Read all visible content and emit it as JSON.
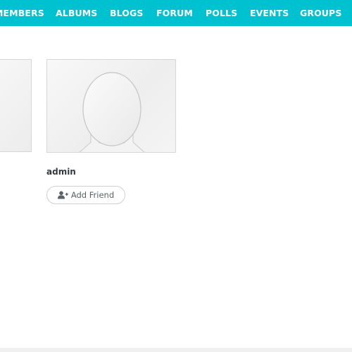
{
  "nav": {
    "items": [
      {
        "label": "MEMBERS"
      },
      {
        "label": "ALBUMS"
      },
      {
        "label": "BLOGS"
      },
      {
        "label": "FORUM"
      },
      {
        "label": "POLLS"
      },
      {
        "label": "EVENTS"
      },
      {
        "label": "GROUPS"
      }
    ],
    "background": "#00c1cf"
  },
  "members": [
    {
      "username": "admin",
      "action_label": "Add Friend",
      "avatar_icon": "default-avatar-silhouette",
      "action_icon": "add-user-icon"
    }
  ]
}
